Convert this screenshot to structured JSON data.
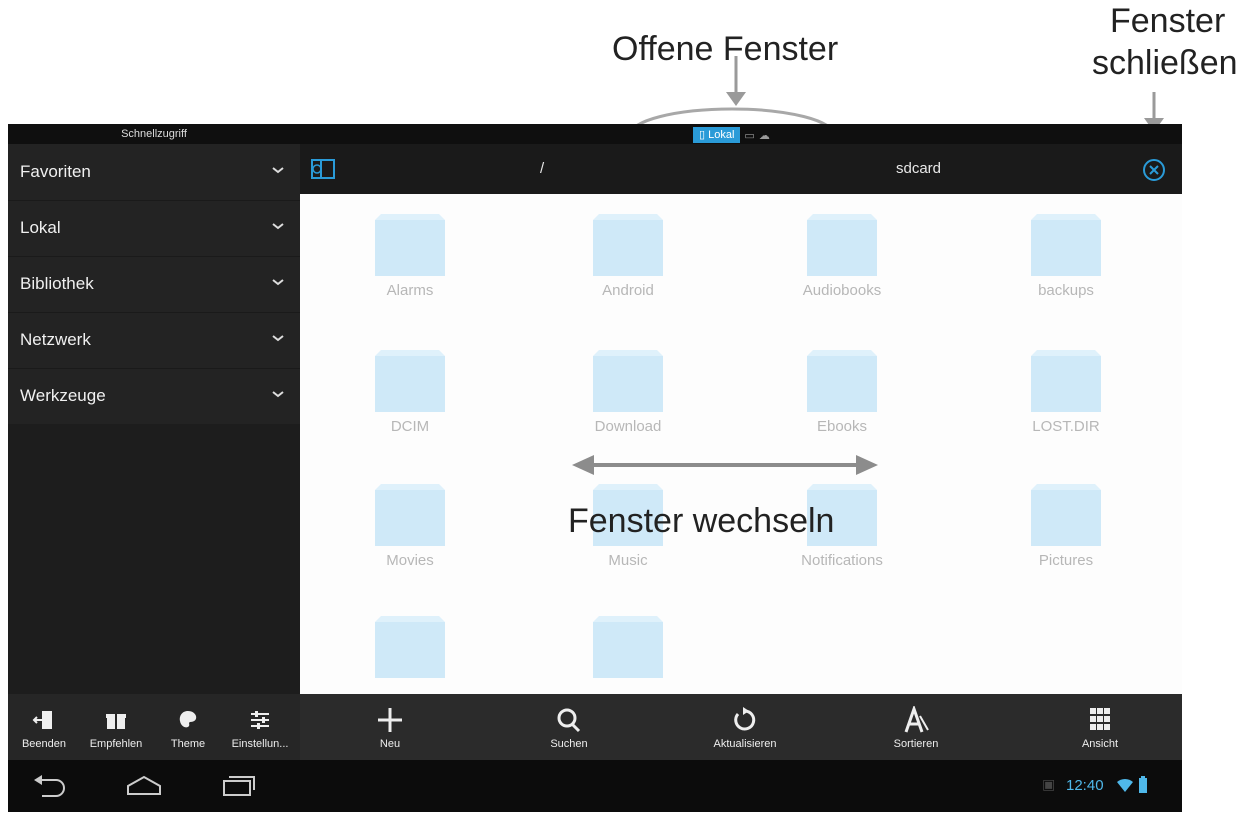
{
  "annotations": {
    "open_windows": "Offene Fenster",
    "close_window_line1": "Fenster",
    "close_window_line2": "schließen",
    "switch_windows": "Fenster wechseln"
  },
  "top_bar": {
    "quick_access": "Schnellzugriff",
    "active_tab": "Lokal"
  },
  "sidebar": {
    "items": [
      {
        "label": "Favoriten"
      },
      {
        "label": "Lokal"
      },
      {
        "label": "Bibliothek"
      },
      {
        "label": "Netzwerk"
      },
      {
        "label": "Werkzeuge"
      }
    ],
    "actions": [
      {
        "label": "Beenden",
        "icon": "exit-icon"
      },
      {
        "label": "Empfehlen",
        "icon": "gift-icon"
      },
      {
        "label": "Theme",
        "icon": "palette-icon"
      },
      {
        "label": "Einstellun...",
        "icon": "sliders-icon"
      }
    ]
  },
  "path": {
    "root": "/",
    "current": "sdcard"
  },
  "folders": [
    {
      "label": "Alarms"
    },
    {
      "label": "Android"
    },
    {
      "label": "Audiobooks"
    },
    {
      "label": "backups"
    },
    {
      "label": "DCIM"
    },
    {
      "label": "Download"
    },
    {
      "label": "Ebooks"
    },
    {
      "label": "LOST.DIR"
    },
    {
      "label": "Movies"
    },
    {
      "label": "Music"
    },
    {
      "label": "Notifications"
    },
    {
      "label": "Pictures"
    },
    {
      "label": ""
    },
    {
      "label": ""
    }
  ],
  "toolbar": {
    "buttons": [
      {
        "label": "Neu",
        "icon": "plus-icon"
      },
      {
        "label": "Suchen",
        "icon": "search-icon"
      },
      {
        "label": "Aktualisieren",
        "icon": "refresh-icon"
      },
      {
        "label": "Sortieren",
        "icon": "sort-icon"
      },
      {
        "label": "Ansicht",
        "icon": "grid-icon"
      }
    ]
  },
  "status": {
    "time": "12:40"
  },
  "colors": {
    "accent": "#2a9bd8",
    "folder": "#cfe9f8",
    "annotation": "#9a9a9a"
  }
}
